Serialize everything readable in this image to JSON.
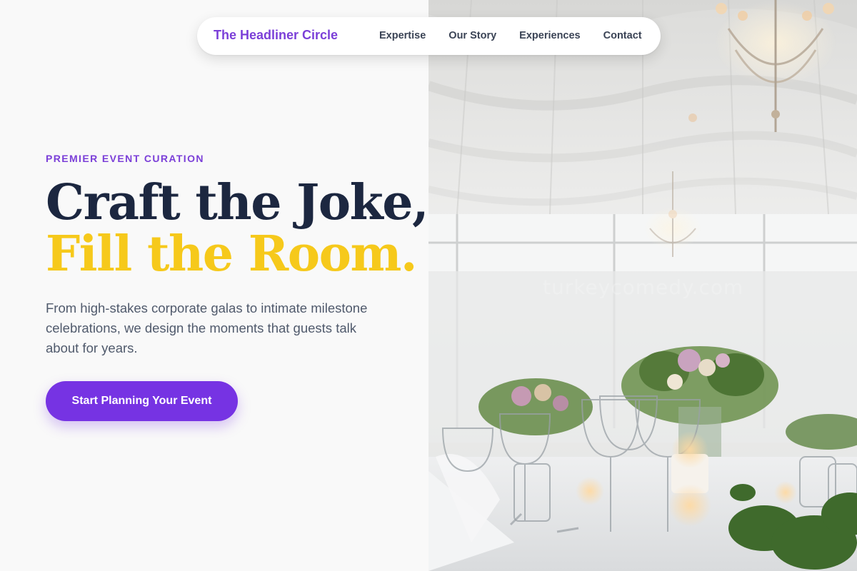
{
  "nav": {
    "brand": "The Headliner Circle",
    "links": [
      {
        "label": "Expertise"
      },
      {
        "label": "Our Story"
      },
      {
        "label": "Experiences"
      },
      {
        "label": "Contact"
      }
    ]
  },
  "hero": {
    "eyebrow": "PREMIER EVENT CURATION",
    "headline_line1": "Craft the Joke,",
    "headline_line2": "Fill the Room.",
    "description": "From high-stakes corporate galas to intimate milestone celebrations, we design the moments that guests talk about for years.",
    "cta_label": "Start Planning Your Event"
  },
  "photo": {
    "watermark": "turkeycomedy.com"
  },
  "colors": {
    "brand_purple": "#7b3fd8",
    "cta_purple": "#7633e3",
    "headline_navy": "#1c2740",
    "headline_gold": "#f6c91b",
    "body_text": "#505a6c",
    "background": "#f9f9f9"
  }
}
